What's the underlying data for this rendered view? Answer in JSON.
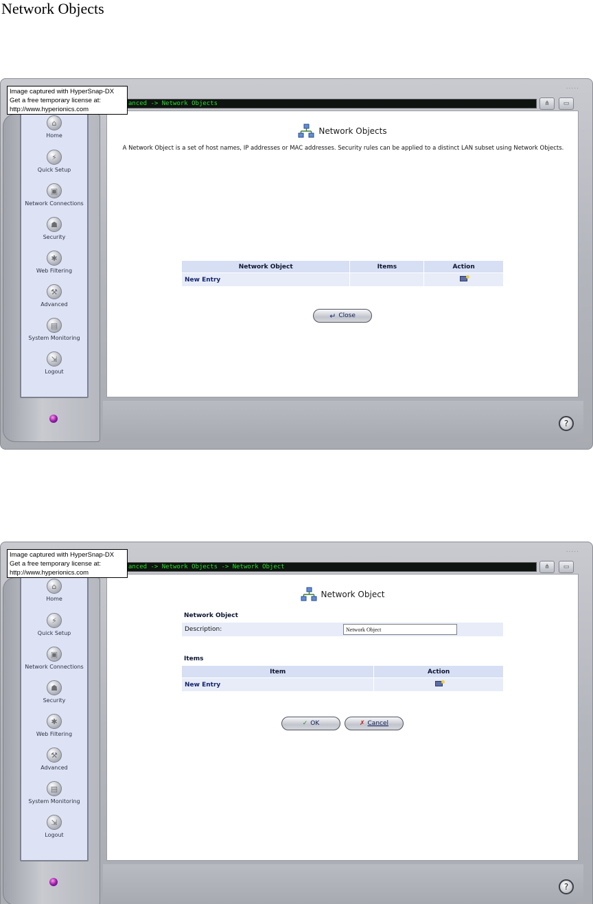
{
  "document": {
    "heading": "Network Objects"
  },
  "watermark": {
    "line1": "Image captured with HyperSnap-DX",
    "line2": "Get a free temporary license at:",
    "line3": "http://www.hyperionics.com"
  },
  "window": {
    "grip": "....."
  },
  "sidebar": {
    "items": [
      {
        "label": "Home",
        "icon": "home-icon"
      },
      {
        "label": "Quick Setup",
        "icon": "quick-setup-icon"
      },
      {
        "label": "Network Connections",
        "icon": "network-connections-icon"
      },
      {
        "label": "Security",
        "icon": "security-icon"
      },
      {
        "label": "Web Filtering",
        "icon": "web-filtering-icon"
      },
      {
        "label": "Advanced",
        "icon": "advanced-icon"
      },
      {
        "label": "System Monitoring",
        "icon": "system-monitoring-icon"
      },
      {
        "label": "Logout",
        "icon": "logout-icon"
      }
    ]
  },
  "screen1": {
    "breadcrumb": "anced -> Network Objects",
    "title": "Network Objects",
    "intro": "A Network Object is a set of host names, IP addresses or MAC addresses. Security rules can be applied to a distinct LAN subset using Network Objects.",
    "table": {
      "headers": [
        "Network Object",
        "Items",
        "Action"
      ],
      "row": {
        "name": "New Entry",
        "items": ""
      }
    },
    "close_label": "Close"
  },
  "screen2": {
    "breadcrumb": "anced -> Network Objects -> Network Object",
    "title": "Network Object",
    "section1": "Network Object",
    "description_label": "Description:",
    "description_value": "Network Object",
    "section2": "Items",
    "table": {
      "headers": [
        "Item",
        "Action"
      ],
      "row": {
        "name": "New Entry"
      }
    },
    "ok_label": "OK",
    "cancel_label": "Cancel"
  },
  "colors": {
    "breadcrumb": "#28e02c",
    "sidebar_bg": "#dde3f5",
    "table_header": "#d6dff3",
    "table_row": "#e7ecf8",
    "link": "#14256b"
  }
}
